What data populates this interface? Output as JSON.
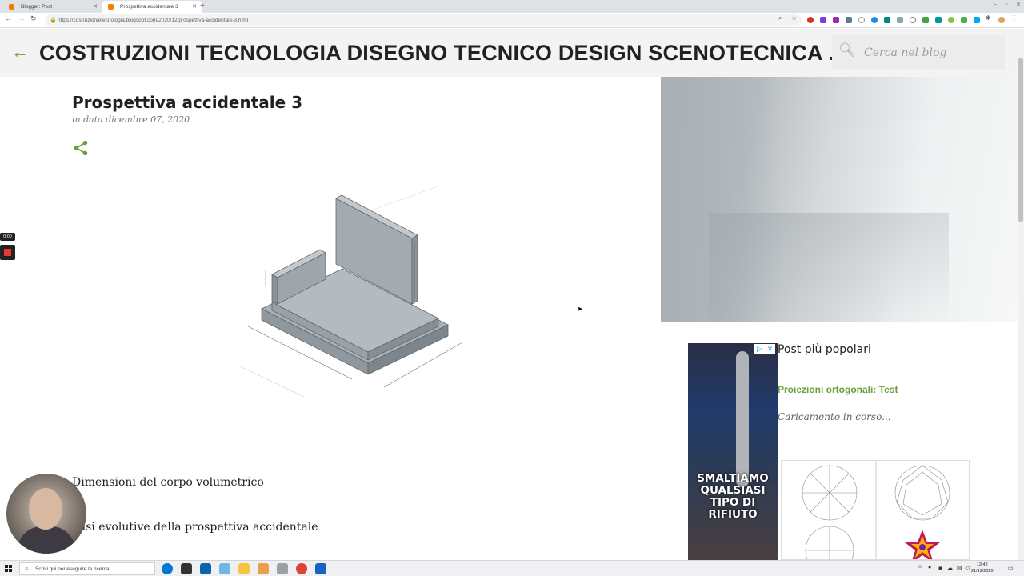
{
  "browser": {
    "tabs": [
      {
        "title": "Blogger: Post",
        "active": false
      },
      {
        "title": "Prospettiva accidentale 3",
        "active": true
      }
    ],
    "url": "https://costruzionietecnologia.blogspot.com/2020/12/prospettiva-accidentale-3.html"
  },
  "blog": {
    "title": "COSTRUZIONI TECNOLOGIA DISEGNO TECNICO DESIGN SCENOTECNICA ...",
    "search_placeholder": "Cerca nel blog",
    "accent_color": "#689f38"
  },
  "post": {
    "title": "Prospettiva accidentale 3",
    "date": "in data dicembre 07, 2020",
    "section_1": "Dimensioni del corpo volumetrico",
    "section_2": "Fasi evolutive della prospettiva accidentale"
  },
  "sidebar": {
    "ad_text": "SMALTIAMO QUALSIASI TIPO DI RIFIUTO",
    "popular_title": "Post più popolari",
    "popular_link": "Proiezioni ortogonali: Test",
    "loading": "Caricamento in corso..."
  },
  "recorder": {
    "time": "0:00"
  },
  "taskbar": {
    "search_placeholder": "Scrivi qui per eseguire la ricerca",
    "time": "13:42",
    "date": "21/12/2020"
  }
}
